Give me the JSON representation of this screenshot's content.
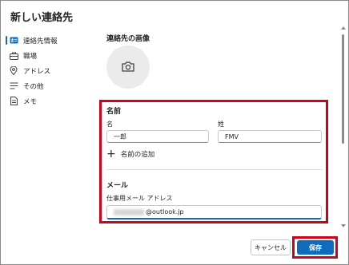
{
  "dialog": {
    "title": "新しい連絡先"
  },
  "nav": {
    "items": [
      {
        "label": "連絡先情報",
        "icon": "contact-card-icon",
        "active": true
      },
      {
        "label": "職場",
        "icon": "briefcase-icon"
      },
      {
        "label": "アドレス",
        "icon": "location-pin-icon"
      },
      {
        "label": "その他",
        "icon": "list-icon"
      },
      {
        "label": "メモ",
        "icon": "note-icon"
      }
    ]
  },
  "photo": {
    "heading": "連絡先の画像",
    "icon": "camera-icon"
  },
  "name_section": {
    "heading": "名前",
    "first_name_label": "名",
    "first_name_value": "一郎",
    "last_name_label": "姓",
    "last_name_value": "FMV",
    "add_name_label": "名前の追加"
  },
  "email_section": {
    "heading": "メール",
    "field_label": "仕事用メール アドレス",
    "field_value_suffix": "@outlook.jp"
  },
  "footer": {
    "cancel_label": "キャンセル",
    "save_label": "保存"
  },
  "colors": {
    "accent": "#0f6cbd",
    "highlight": "#d0021b"
  }
}
